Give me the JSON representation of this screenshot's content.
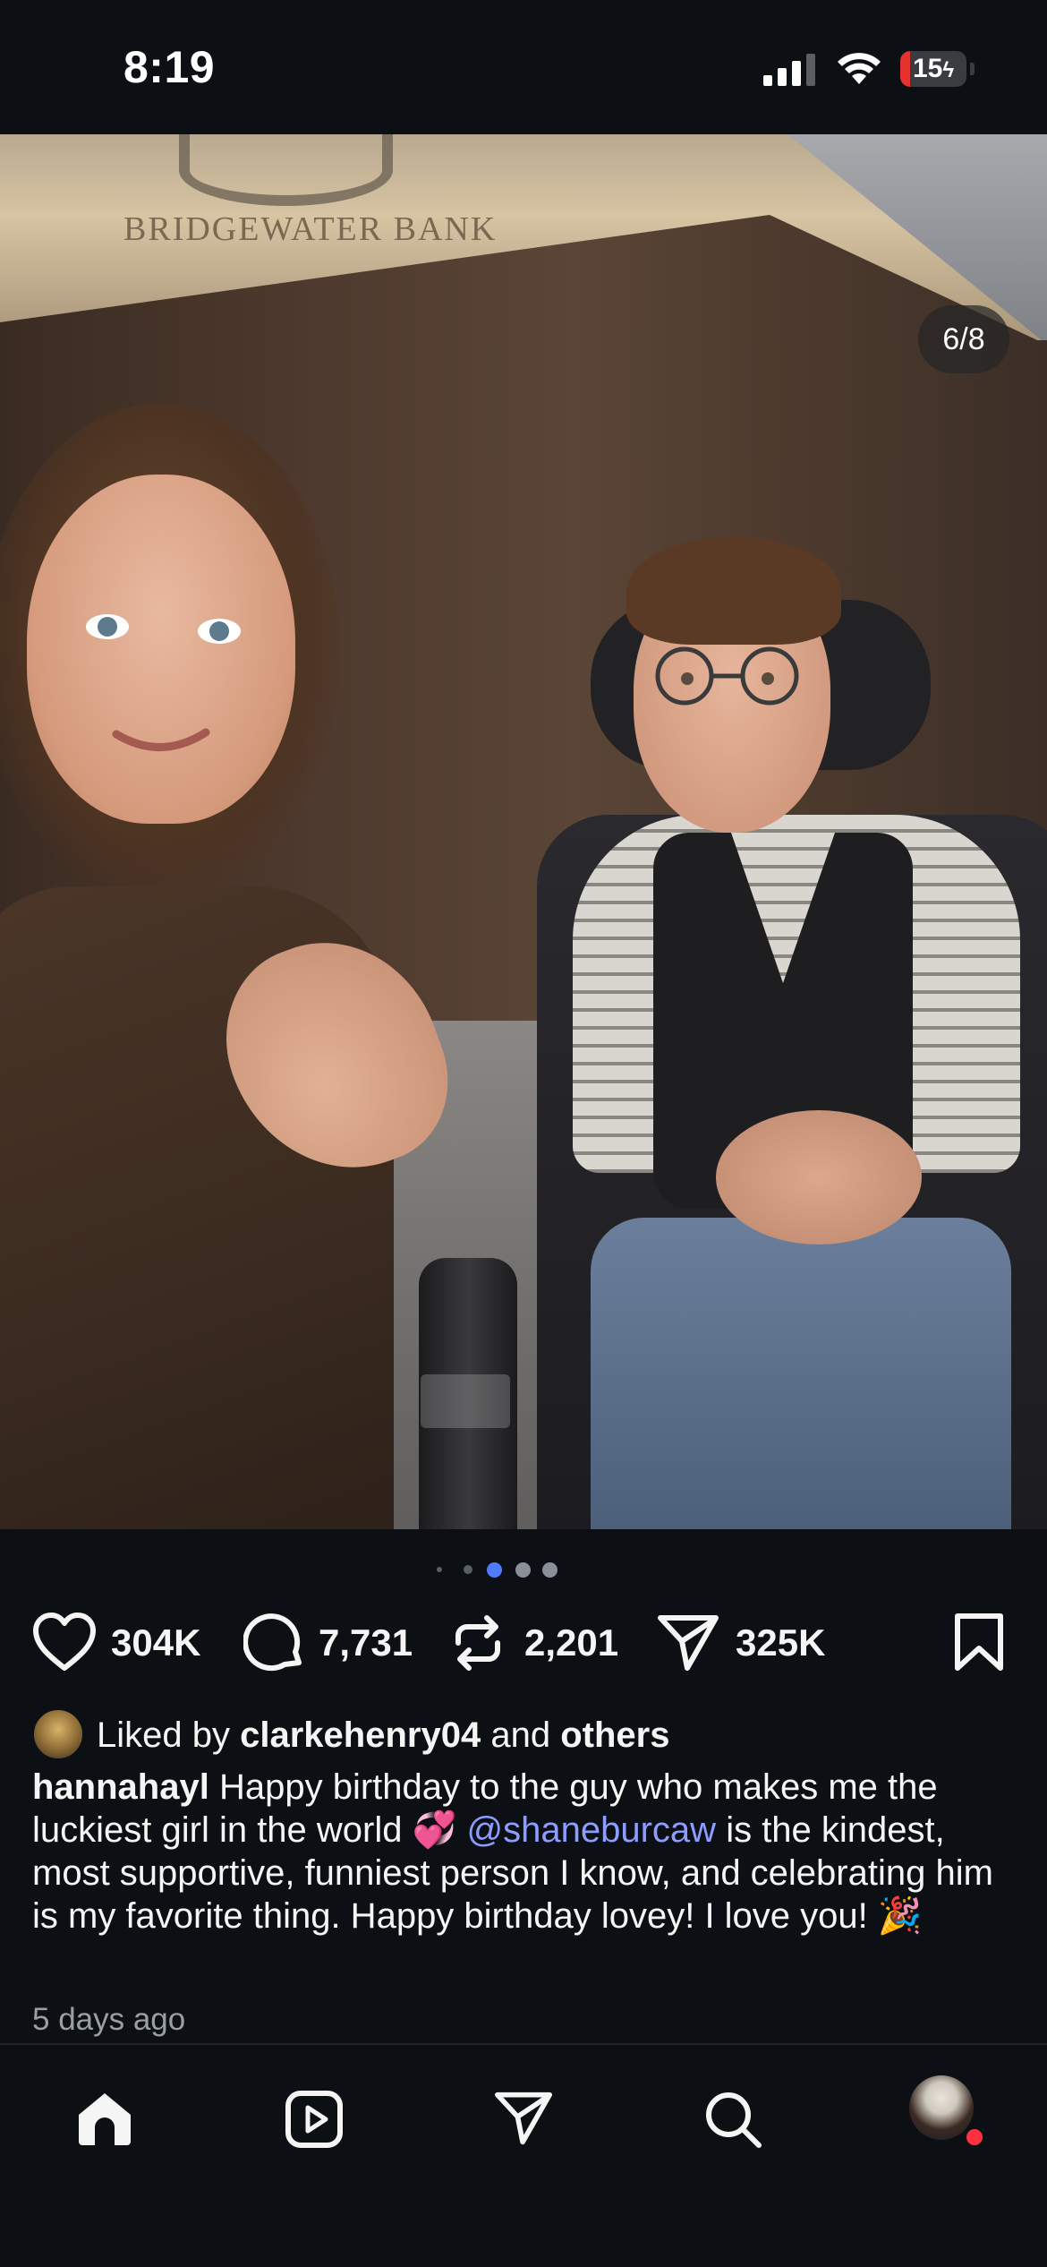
{
  "status_bar": {
    "time": "8:19",
    "battery_level": "15",
    "battery_percent": 15,
    "battery_charging": true,
    "colors": {
      "battery_low": "#e5322e"
    }
  },
  "post": {
    "photo_sign_text": "BRIDGEWATER BANK",
    "carousel_counter": "6/8",
    "carousel_dots": {
      "count": 5,
      "active_index": 2
    },
    "icons": {
      "mute": "speaker-muted-icon"
    }
  },
  "actions": {
    "like": {
      "icon": "heart-icon",
      "count": "304K"
    },
    "comment": {
      "icon": "comment-bubble-icon",
      "count": "7,731"
    },
    "repost": {
      "icon": "repost-icon",
      "count": "2,201"
    },
    "share": {
      "icon": "paper-plane-icon",
      "count": "325K"
    },
    "save": {
      "icon": "bookmark-icon"
    }
  },
  "liked_by": {
    "prefix": "Liked by",
    "user": "clarkehenry04",
    "conjunction": "and",
    "others": "others"
  },
  "caption": {
    "username": "hannahayl",
    "text_part1": " Happy birthday to the guy who makes me the luckiest girl in the world 💞 ",
    "mention": "@shaneburcaw",
    "text_part2": " is the kindest, most supportive, funniest person I know, and celebrating him is my favorite thing. Happy birthday lovey! I love you! 🎉",
    "colors": {
      "mention": "#8c9cff"
    }
  },
  "timestamp": "5 days ago",
  "tab_bar": {
    "items": [
      {
        "name": "home",
        "icon": "home-icon",
        "active": true
      },
      {
        "name": "reels",
        "icon": "reels-icon"
      },
      {
        "name": "messages",
        "icon": "paper-plane-icon"
      },
      {
        "name": "search",
        "icon": "search-icon"
      },
      {
        "name": "profile",
        "icon": "profile-avatar"
      }
    ],
    "colors": {
      "notification": "#ff3040"
    }
  }
}
